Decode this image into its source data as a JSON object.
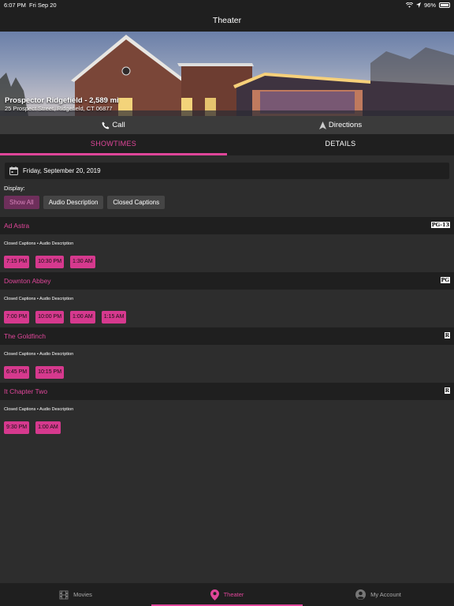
{
  "status": {
    "time": "6:07 PM",
    "date": "Fri Sep 20",
    "battery": "96%"
  },
  "nav": {
    "title": "Theater"
  },
  "theater": {
    "name": "Prospector Ridgefield - 2,589 mi",
    "address": "25 Prospect Street, Ridgefield, CT 06877"
  },
  "actions": {
    "call": "Call",
    "directions": "Directions"
  },
  "tabs": {
    "showtimes": "SHOWTIMES",
    "details": "DETAILS"
  },
  "date_selector": "Friday, September 20, 2019",
  "display": {
    "label": "Display:",
    "options": [
      "Show All",
      "Audio Description",
      "Closed Captions"
    ],
    "selected": "Show All"
  },
  "movies": [
    {
      "title": "Ad Astra",
      "rating": "PG-13",
      "info": "Closed Captions • Audio Description",
      "times": [
        "7:15 PM",
        "10:30 PM",
        "1:30 AM"
      ]
    },
    {
      "title": "Downton Abbey",
      "rating": "PG",
      "info": "Closed Captions • Audio Description",
      "times": [
        "7:00 PM",
        "10:00 PM",
        "1:00 AM",
        "1:15 AM"
      ]
    },
    {
      "title": "The Goldfinch",
      "rating": "R",
      "info": "Closed Captions • Audio Description",
      "times": [
        "6:45 PM",
        "10:15 PM"
      ]
    },
    {
      "title": "It Chapter Two",
      "rating": "R",
      "info": "Closed Captions • Audio Description",
      "times": [
        "9:30 PM",
        "1:00 AM"
      ]
    }
  ],
  "bottom_nav": [
    {
      "label": "Movies",
      "icon": "film-icon",
      "active": false
    },
    {
      "label": "Theater",
      "icon": "location-pin-icon",
      "active": true
    },
    {
      "label": "My Account",
      "icon": "account-icon",
      "active": false
    }
  ],
  "colors": {
    "accent": "#e0469a",
    "background": "#2d2d2d",
    "bar": "#1f1f1f"
  }
}
